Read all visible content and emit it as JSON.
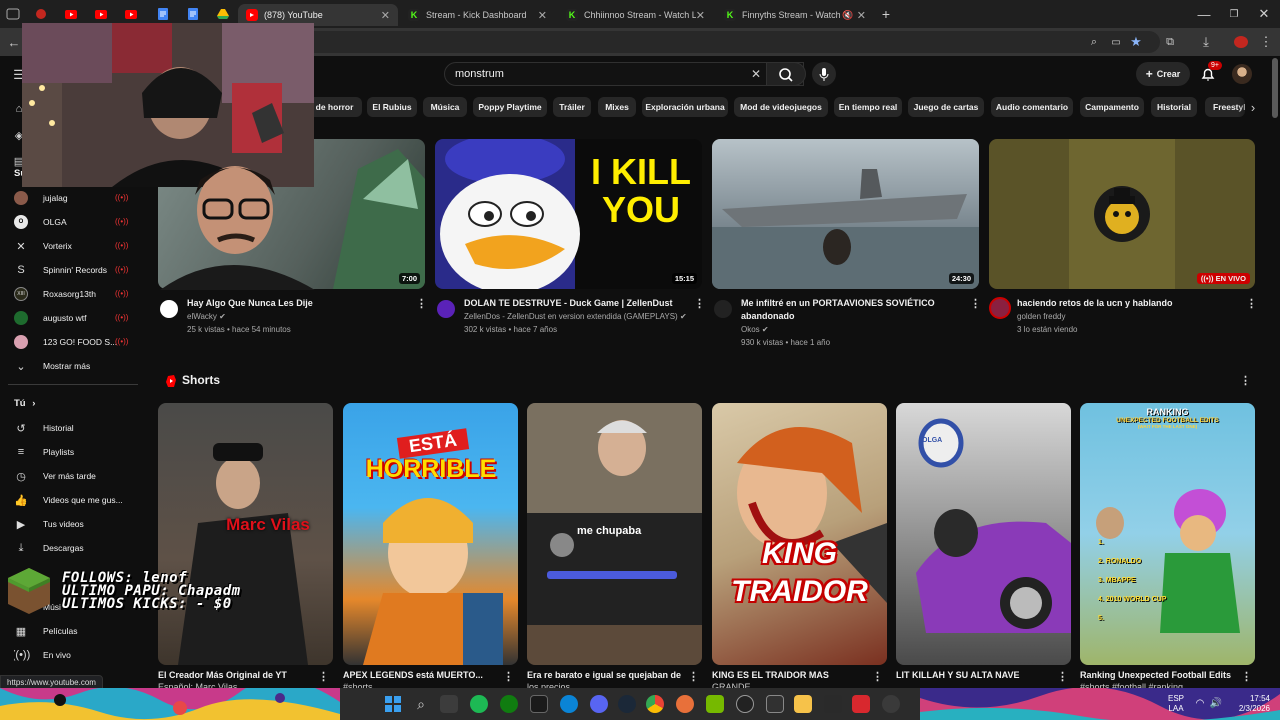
{
  "browser": {
    "tabs": [
      {
        "label": "(878) YouTube",
        "icon": "youtube-icon",
        "active": true
      },
      {
        "label": "Stream - Kick Dashboard",
        "icon": "kick-icon",
        "active": false
      },
      {
        "label": "Chhiinnoo Stream - Watch Live",
        "icon": "kick-icon",
        "active": false
      },
      {
        "label": "Finnyths Stream - Watch Live",
        "icon": "kick-icon",
        "active": false
      }
    ],
    "status_url": "https://www.youtube.com"
  },
  "youtube": {
    "search_value": "monstrum",
    "create_label": "Crear",
    "notif_count": "9+",
    "chips": [
      "s de horror",
      "El Rubius",
      "Música",
      "Poppy Playtime",
      "Tráiler",
      "Mixes",
      "Exploración urbana",
      "Mod de videojuegos",
      "En tiempo real",
      "Juego de cartas",
      "Audio comentario",
      "Campamento",
      "Historial",
      "Freestyle"
    ],
    "sidebar": {
      "subs_header": "Su",
      "subscriptions": [
        {
          "name": "jujalag",
          "live": true,
          "color": "#8a5a4a"
        },
        {
          "name": "OLGA",
          "live": true,
          "color": "#e8e8e8"
        },
        {
          "name": "Vorterix",
          "live": true,
          "color": "#111111"
        },
        {
          "name": "Spinnin' Records",
          "live": true,
          "color": "#111111"
        },
        {
          "name": "Roxasorg13th",
          "live": true,
          "color": "#2a2a1a"
        },
        {
          "name": "augusto wtf",
          "live": true,
          "color": "#1e6b2e"
        },
        {
          "name": "123 GO! FOOD S...",
          "live": true,
          "color": "#d9a0b0"
        }
      ],
      "show_more": "Mostrar más",
      "you_header": "Tú",
      "you_items": [
        {
          "label": "Historial",
          "icon": "history-icon"
        },
        {
          "label": "Playlists",
          "icon": "playlists-icon"
        },
        {
          "label": "Ver más tarde",
          "icon": "watch-later-icon"
        },
        {
          "label": "Videos que me gus...",
          "icon": "like-icon"
        },
        {
          "label": "Tus videos",
          "icon": "your-videos-icon"
        },
        {
          "label": "Descargas",
          "icon": "download-icon"
        }
      ],
      "explore_partial": "Músi",
      "explore_items": [
        {
          "label": "Películas",
          "icon": "movies-icon"
        },
        {
          "label": "En vivo",
          "icon": "live-icon"
        }
      ]
    },
    "videos": [
      {
        "title": "Hay Algo Que Nunca Les Dije",
        "channel": "elWacky",
        "verified": true,
        "stats": "25 k vistas • hace 54 minutos",
        "duration": "7:00"
      },
      {
        "title": "DOLAN TE DESTRUYE - Duck Game | ZellenDust",
        "channel": "ZellenDos - ZellenDust en version extendida (GAMEPLAYS)",
        "verified": true,
        "stats": "302 k vistas • hace 7 años",
        "duration": "15:15",
        "thumb_text": "I KILL YOU"
      },
      {
        "title": "Me infiltré en un PORTAAVIONES SOVIÉTICO abandonado",
        "channel": "Okos",
        "verified": true,
        "stats": "930 k vistas • hace 1 año",
        "duration": "24:30"
      },
      {
        "title": "haciendo retos de la ucn y hablando",
        "channel": "golden freddy",
        "verified": false,
        "stats": "3 lo están viendo",
        "live_badge": "EN VIVO"
      }
    ],
    "shorts_header": "Shorts",
    "shorts": [
      {
        "title": "El Creador Más Original de YT",
        "sub": "Español: Marc Vilas",
        "overlay": "Marc Vilas"
      },
      {
        "title": "APEX LEGENDS está MUERTO...",
        "sub": "#shorts",
        "overlay_top": "ESTÁ",
        "overlay_main": "HORRIBLE"
      },
      {
        "title": "Era re barato e igual se quejaban de",
        "sub": "los precios",
        "overlay": "me chupaba"
      },
      {
        "title": "KING ES EL TRAIDOR MAS",
        "sub": "GRANDE",
        "overlay_top": "KING",
        "overlay_main": "TRAIDOR"
      },
      {
        "title": "LIT KILLAH Y SU ALTA NAVE",
        "sub": "",
        "overlay": "OLGA"
      },
      {
        "title": "Ranking Unexpected Football Edits",
        "sub": "#shorts #football #ranking",
        "overlay_top": "RANKING",
        "overlay_main": "UNEXPECTED FOOTBALL EDITS",
        "overlay_sub": "(WAIT FOR THE LAST ONE)",
        "ranks": [
          "1.",
          "2. RONALDO",
          "3. MBAPPE",
          "4. 2010 WORLD CUP",
          "5."
        ]
      }
    ]
  },
  "stream_overlay": {
    "lines": [
      "FOLLOWS: lenof",
      "ULTIMO PAPU: Chapadm",
      "ULTIMOS KICKS:   - $0"
    ]
  },
  "taskbar": {
    "lang": "ESP",
    "lang_sub": "LAA",
    "time": "17:54",
    "date": "2/3/2026"
  },
  "colors": {
    "yt_red": "#ff0000",
    "kick_green": "#53fc18",
    "bg": "#0f0f0f",
    "chip": "#272727"
  }
}
